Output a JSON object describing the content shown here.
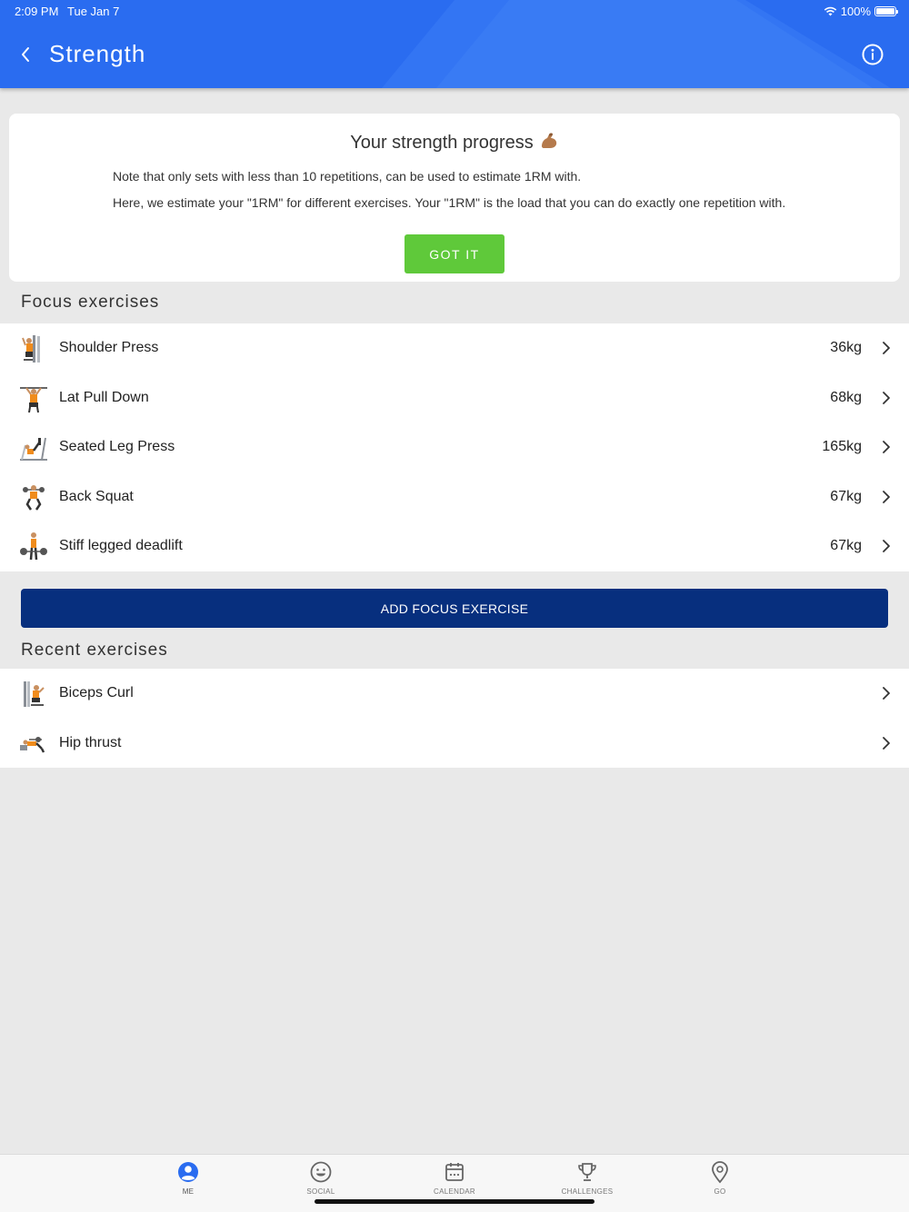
{
  "status": {
    "time": "2:09 PM",
    "date": "Tue Jan 7",
    "battery": "100%"
  },
  "header": {
    "title": "Strength"
  },
  "card": {
    "title": "Your strength progress",
    "note": "Note that only sets with less than 10 repetitions, can be used to estimate 1RM with.",
    "description": "Here, we estimate your \"1RM\" for different exercises. Your \"1RM\" is the load that you can do exactly one repetition with.",
    "button": "GOT IT"
  },
  "focus": {
    "title": "Focus exercises",
    "items": [
      {
        "name": "Shoulder Press",
        "value": "36kg"
      },
      {
        "name": "Lat Pull Down",
        "value": "68kg"
      },
      {
        "name": "Seated Leg Press",
        "value": "165kg"
      },
      {
        "name": "Back Squat",
        "value": "67kg"
      },
      {
        "name": "Stiff legged deadlift",
        "value": "67kg"
      }
    ],
    "add_button": "ADD FOCUS EXERCISE"
  },
  "recent": {
    "title": "Recent exercises",
    "items": [
      {
        "name": "Biceps Curl"
      },
      {
        "name": "Hip thrust"
      }
    ]
  },
  "tabs": [
    {
      "label": "ME",
      "icon": "person-icon",
      "active": true
    },
    {
      "label": "SOCIAL",
      "icon": "smiley-icon"
    },
    {
      "label": "CALENDAR",
      "icon": "calendar-icon"
    },
    {
      "label": "CHALLENGES",
      "icon": "trophy-icon"
    },
    {
      "label": "GO",
      "icon": "location-pin-icon"
    }
  ],
  "colors": {
    "header": "#2a6cf0",
    "primary_button": "#072f7e",
    "success": "#5fc93a",
    "active_tab": "#2a6cf0"
  }
}
